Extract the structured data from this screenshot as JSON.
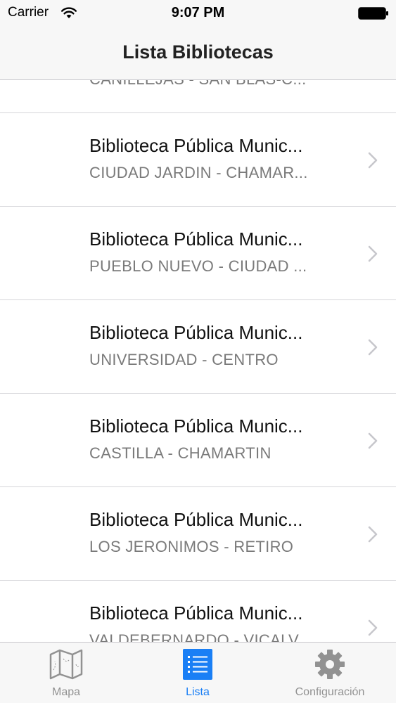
{
  "status_bar": {
    "carrier": "Carrier",
    "time": "9:07 PM",
    "wifi_icon": "wifi-icon",
    "battery_icon": "battery-icon"
  },
  "nav": {
    "title": "Lista Bibliotecas"
  },
  "list": {
    "partial_top_subtitle": "CANILLEJAS - SAN BLAS-C...",
    "items": [
      {
        "title": "Biblioteca Pública Munic...",
        "subtitle": "CIUDAD JARDIN - CHAMAR..."
      },
      {
        "title": "Biblioteca Pública Munic...",
        "subtitle": "PUEBLO NUEVO - CIUDAD ..."
      },
      {
        "title": "Biblioteca Pública Munic...",
        "subtitle": "UNIVERSIDAD - CENTRO"
      },
      {
        "title": "Biblioteca Pública Munic...",
        "subtitle": "CASTILLA - CHAMARTIN"
      },
      {
        "title": "Biblioteca Pública Munic...",
        "subtitle": "LOS JERONIMOS - RETIRO"
      },
      {
        "title": "Biblioteca Pública Munic...",
        "subtitle": "VALDEBERNARDO - VICALV..."
      }
    ]
  },
  "tab_bar": {
    "tabs": [
      {
        "label": "Mapa",
        "icon": "map-icon",
        "active": false
      },
      {
        "label": "Lista",
        "icon": "list-icon",
        "active": true
      },
      {
        "label": "Configuración",
        "icon": "gear-icon",
        "active": false
      }
    ]
  },
  "colors": {
    "accent": "#1a7ff5",
    "inactive": "#929292",
    "separator": "#d6d6da",
    "bar_background": "#f7f7f7"
  }
}
